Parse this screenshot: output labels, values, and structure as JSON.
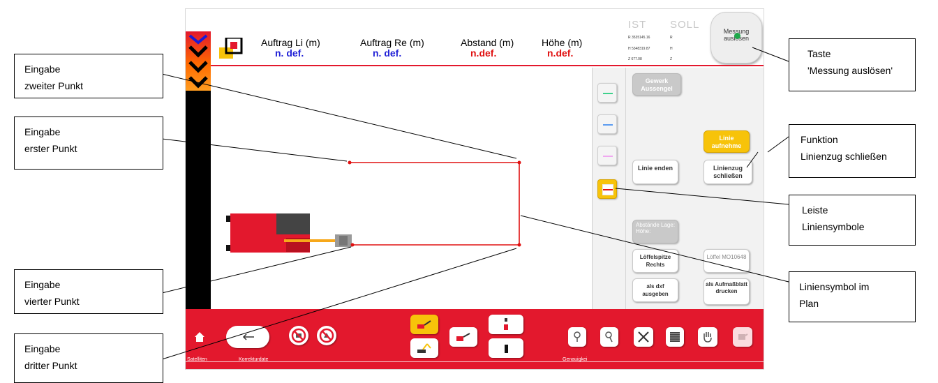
{
  "header": {
    "columns": [
      {
        "label": "Auftrag Li (m)",
        "value": "n. def.",
        "color": "#1f1fd6"
      },
      {
        "label": "Auftrag Re (m)",
        "value": "n. def.",
        "color": "#1f1fd6"
      },
      {
        "label": "Abstand (m)",
        "value": "n.def.",
        "color": "#e01010"
      },
      {
        "label": "Höhe (m)",
        "value": "n.def.",
        "color": "#e01010"
      }
    ],
    "ist_label": "IST",
    "soll_label": "SOLL",
    "coords": [
      {
        "ist": "R 3535145.16",
        "soll": "R"
      },
      {
        "ist": "H 5348319.87",
        "soll": "H"
      },
      {
        "ist": "Z 677.08",
        "soll": "Z"
      }
    ],
    "measure_button": "Messung auslösen"
  },
  "right_panel": {
    "gewerk": "Gewerk Aussengel",
    "linie_aufnehmen": "Linie aufnehme",
    "linie_enden": "Linie enden",
    "linienzug_schliessen": "Linienzug schließen",
    "abstaende": "Abstände Lage: Höhe:",
    "loeffelspitze": "Löffelspitze Rechts",
    "loeffel": "Löffel MO10648",
    "als_dxf": "als dxf ausgeben",
    "als_aufmass": "als Aufmaßblatt drucken",
    "line_symbols": [
      {
        "name": "green",
        "color": "#3fd18c"
      },
      {
        "name": "blue",
        "color": "#5c9cf0"
      },
      {
        "name": "pink",
        "color": "#f0a8f0"
      },
      {
        "name": "red-selected",
        "color": "#e01010"
      }
    ]
  },
  "bottom_bar": {
    "labels": [
      "Satelliten",
      "Korrekturdate",
      "Genauigkei"
    ],
    "icons": [
      "home-icon",
      "back-arrow-icon",
      "no-satellite-icon",
      "no-correction-icon",
      "excavator-arm-icon",
      "excavator-bucket-icon",
      "excavator-tool-icon",
      "marker-top-icon",
      "marker-bottom-icon",
      "zoom-in-icon",
      "zoom-out-icon",
      "fit-extent-icon",
      "grid-icon",
      "pan-hand-icon",
      "disabled-icon"
    ]
  },
  "callouts": {
    "zweiter": [
      "Eingabe",
      "zweiter Punkt"
    ],
    "erster": [
      "Eingabe",
      "erster Punkt"
    ],
    "vierter": [
      "Eingabe",
      "vierter Punkt"
    ],
    "dritter": [
      "Eingabe",
      "dritter Punkt"
    ],
    "taste": [
      "Taste",
      "'Messung auslösen'"
    ],
    "funktion": [
      "Funktion",
      "Linienzug schließen"
    ],
    "leiste": [
      "Leiste",
      "Liniensymbole"
    ],
    "liniensymbol": [
      "Liniensymbol im",
      "Plan"
    ]
  },
  "colors": {
    "accent_red": "#e3182d",
    "accent_yellow": "#f7c30a",
    "plan_line": "#e01010"
  }
}
